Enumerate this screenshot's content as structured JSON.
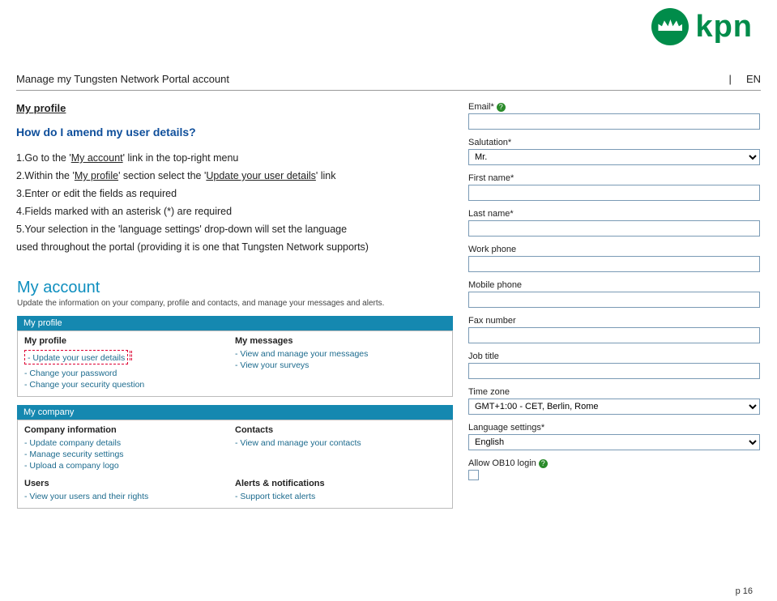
{
  "logo_text": "kpn",
  "header": {
    "title": "Manage my Tungsten Network Portal account",
    "separator": "|",
    "lang": "EN"
  },
  "section": "My profile",
  "question": "How do I amend my user details?",
  "steps": {
    "s1a": "1.Go to the ",
    "s1b": "My account",
    "s1c": " link in the top-right menu",
    "s2a": "2.Within the ",
    "s2b": "My profile",
    "s2c": " section select the ",
    "s2d": "Update your user details",
    "s2e": " link",
    "s3": "3.Enter or edit the fields as required",
    "s4": "4.Fields marked with an asterisk (*) are required",
    "s5a": "5.Your selection in the 'language settings' drop-down will set the language",
    "s5b": "used throughout the portal (providing it is one that Tungsten Network supports)"
  },
  "account": {
    "title": "My account",
    "subtitle": "Update the information on your company, profile and contacts, and manage your messages and alerts.",
    "bar1": "My profile",
    "col1h": "My profile",
    "l1": "- Update your user details",
    "l2": "- Change your password",
    "l3": "- Change your security question",
    "col2h": "My messages",
    "l4": "- View and manage your messages",
    "l5": "- View your surveys",
    "bar2": "My company",
    "col3h": "Company information",
    "l6": "- Update company details",
    "l7": "- Manage security settings",
    "l8": "- Upload a company logo",
    "col4h": "Contacts",
    "l9": "- View and manage your contacts",
    "col5h": "Users",
    "l10": "- View your users and their rights",
    "col6h": "Alerts & notifications",
    "l11": "- Support ticket alerts"
  },
  "form": {
    "email": "Email*",
    "salutation": "Salutation*",
    "salutation_val": "Mr.",
    "first": "First name*",
    "last": "Last name*",
    "workphone": "Work phone",
    "mobile": "Mobile phone",
    "fax": "Fax number",
    "job": "Job title",
    "tz": "Time zone",
    "tz_val": "GMT+1:00 - CET, Berlin, Rome",
    "lang": "Language settings*",
    "lang_val": "English",
    "ob10": "Allow OB10 login"
  },
  "page_num": "p 16"
}
